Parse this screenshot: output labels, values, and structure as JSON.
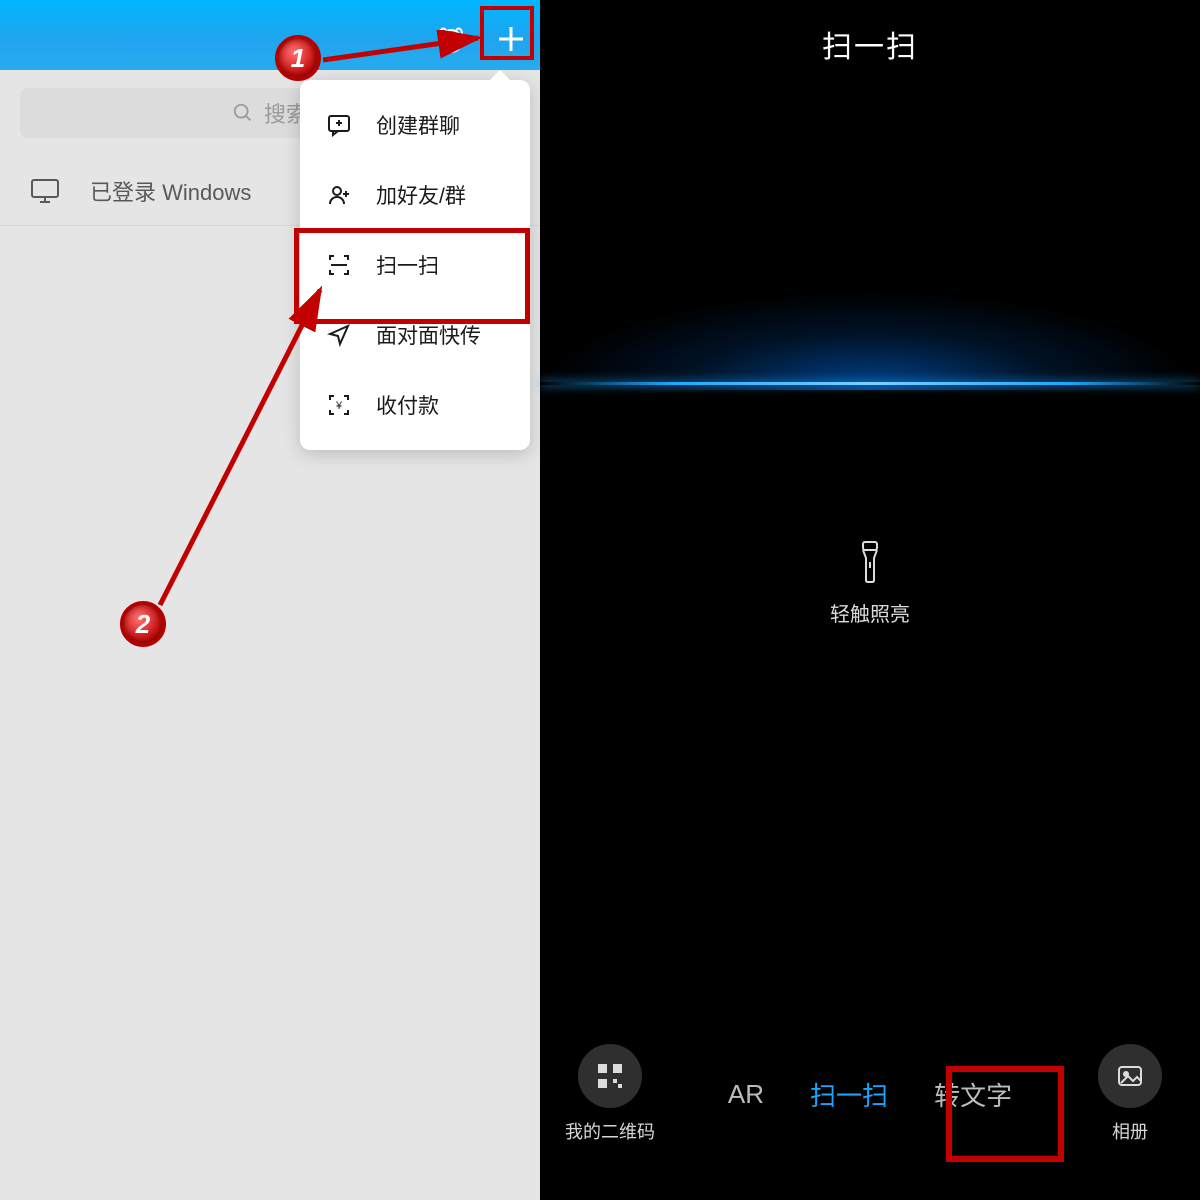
{
  "left": {
    "search_placeholder": "搜索",
    "login_status": "已登录 Windows",
    "menu": {
      "create_group": "创建群聊",
      "add_friend": "加好友/群",
      "scan": "扫一扫",
      "face_transfer": "面对面快传",
      "payment": "收付款"
    },
    "annotation": {
      "badge1": "1",
      "badge2": "2"
    }
  },
  "right": {
    "title": "扫一扫",
    "torch_hint": "轻触照亮",
    "qr_label": "我的二维码",
    "album_label": "相册",
    "modes": {
      "ar": "AR",
      "scan": "扫一扫",
      "text": "转文字"
    }
  }
}
